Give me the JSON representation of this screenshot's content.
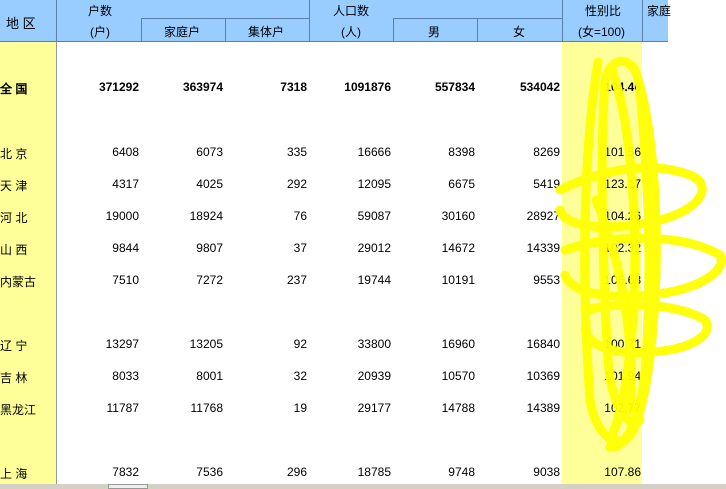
{
  "header": {
    "region": "地 区",
    "households": "户数",
    "households_unit": "(户)",
    "family_households": "家庭户",
    "collective_households": "集体户",
    "population": "人口数",
    "population_unit": "(人)",
    "male": "男",
    "female": "女",
    "sex_ratio": "性别比",
    "sex_ratio_unit": "(女=100)",
    "family_cut": "家庭"
  },
  "rows": [
    {
      "name": "全 国",
      "households": "371292",
      "family": "363974",
      "collective": "7318",
      "population": "1091876",
      "male": "557834",
      "female": "534042",
      "ratio": "104.46"
    },
    {
      "name": "北 京",
      "households": "6408",
      "family": "6073",
      "collective": "335",
      "population": "16666",
      "male": "8398",
      "female": "8269",
      "ratio": "101.56"
    },
    {
      "name": "天 津",
      "households": "4317",
      "family": "4025",
      "collective": "292",
      "population": "12095",
      "male": "6675",
      "female": "5419",
      "ratio": "123.17"
    },
    {
      "name": "河 北",
      "households": "19000",
      "family": "18924",
      "collective": "76",
      "population": "59087",
      "male": "30160",
      "female": "28927",
      "ratio": "104.26"
    },
    {
      "name": "山 西",
      "households": "9844",
      "family": "9807",
      "collective": "37",
      "population": "29012",
      "male": "14672",
      "female": "14339",
      "ratio": "102.32"
    },
    {
      "name": "内蒙古",
      "households": "7510",
      "family": "7272",
      "collective": "237",
      "population": "19744",
      "male": "10191",
      "female": "9553",
      "ratio": "106.68"
    },
    {
      "name": "辽 宁",
      "households": "13297",
      "family": "13205",
      "collective": "92",
      "population": "33800",
      "male": "16960",
      "female": "16840",
      "ratio": "100.71"
    },
    {
      "name": "吉 林",
      "households": "8033",
      "family": "8001",
      "collective": "32",
      "population": "20939",
      "male": "10570",
      "female": "10369",
      "ratio": "101.94"
    },
    {
      "name": "黑龙江",
      "households": "11787",
      "family": "11768",
      "collective": "19",
      "population": "29177",
      "male": "14788",
      "female": "14389",
      "ratio": "102.77"
    },
    {
      "name": "上 海",
      "households": "7832",
      "family": "7536",
      "collective": "296",
      "population": "18785",
      "male": "9748",
      "female": "9038",
      "ratio": "107.86"
    }
  ],
  "colors": {
    "header_bg": "#99ccff",
    "highlight_col": "#ffff99",
    "scribble": "#ffff00"
  }
}
